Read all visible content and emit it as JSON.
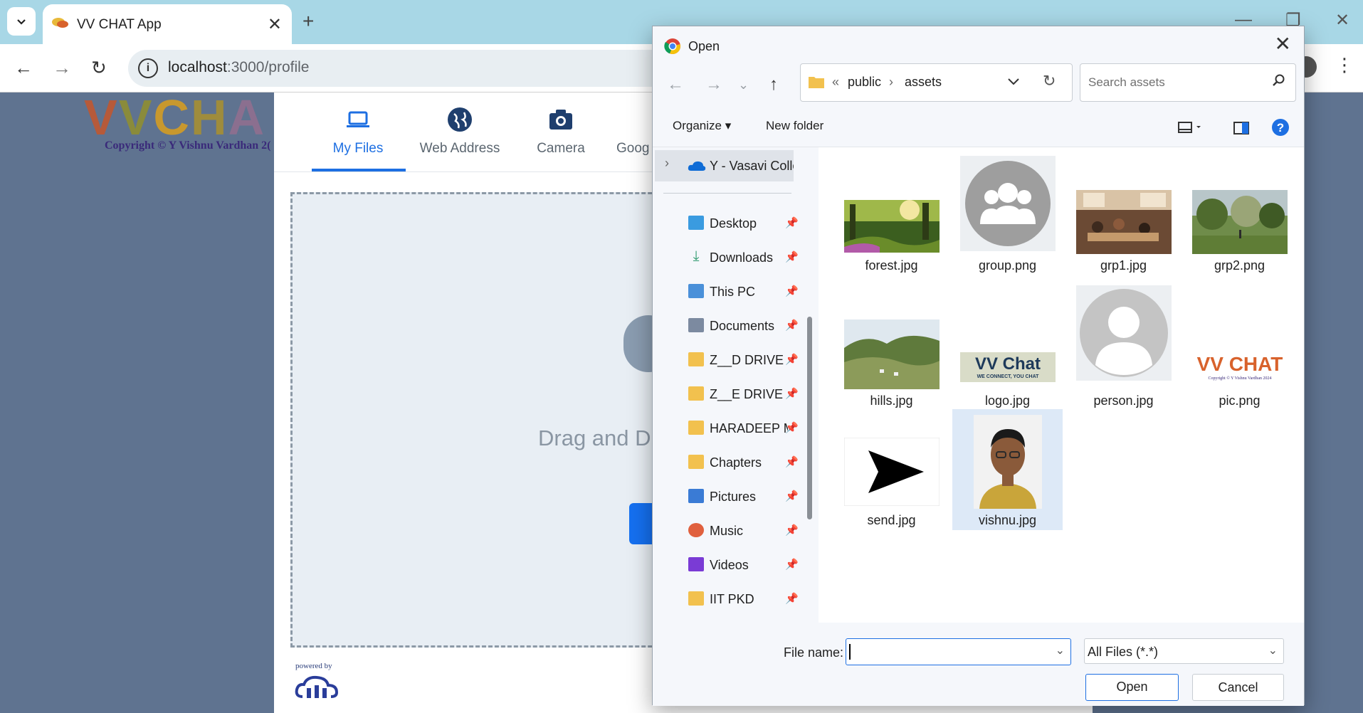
{
  "browser": {
    "tab_title": "VV CHAT App",
    "url_host": "localhost",
    "url_path": ":3000/profile",
    "colors": {
      "tabstrip": "#a8d7e6",
      "accent": "#1d6fe2"
    }
  },
  "page": {
    "brand_letters": [
      "V",
      "V",
      "C",
      "H",
      "A",
      ""
    ],
    "copyright": "Copyright © Y Vishnu Vardhan 2("
  },
  "upload_widget": {
    "tabs": [
      {
        "label": "My Files",
        "icon": "laptop-icon",
        "active": true
      },
      {
        "label": "Web Address",
        "icon": "globe-icon"
      },
      {
        "label": "Camera",
        "icon": "camera-icon"
      },
      {
        "label": "Goog",
        "icon": "google-drive-icon"
      }
    ],
    "drag_text": "Drag and Dr",
    "powered_by": "powered by"
  },
  "dialog": {
    "title": "Open",
    "address": {
      "overflow": "«",
      "crumbs": [
        "public",
        "assets"
      ]
    },
    "search_placeholder": "Search assets",
    "commands": {
      "organize": "Organize",
      "new_folder": "New folder"
    },
    "cloud_item": "Y - Vasavi College",
    "sidebar_items": [
      {
        "label": "Desktop",
        "icon": "desktop-icon",
        "color": "#3a9be0"
      },
      {
        "label": "Downloads",
        "icon": "download-icon",
        "color": "#2e9a6e"
      },
      {
        "label": "This PC",
        "icon": "computer-icon",
        "color": "#4a90d9"
      },
      {
        "label": "Documents",
        "icon": "document-icon",
        "color": "#7c8aa0"
      },
      {
        "label": "Z__D DRIVE",
        "icon": "folder-icon",
        "color": "#f2c14e"
      },
      {
        "label": "Z__E DRIVE",
        "icon": "folder-icon",
        "color": "#f2c14e"
      },
      {
        "label": "HARADEEP M",
        "icon": "folder-icon",
        "color": "#f2c14e"
      },
      {
        "label": "Chapters",
        "icon": "folder-icon",
        "color": "#f2c14e"
      },
      {
        "label": "Pictures",
        "icon": "pictures-icon",
        "color": "#3a7bd5"
      },
      {
        "label": "Music",
        "icon": "music-icon",
        "color": "#e0603e"
      },
      {
        "label": "Videos",
        "icon": "videos-icon",
        "color": "#7a3bd5"
      },
      {
        "label": "IIT PKD",
        "icon": "folder-icon",
        "color": "#f2c14e"
      }
    ],
    "files": [
      {
        "name": "forest.jpg",
        "kind": "photo-forest"
      },
      {
        "name": "group.png",
        "kind": "group-avatar"
      },
      {
        "name": "grp1.jpg",
        "kind": "photo-cafe"
      },
      {
        "name": "grp2.png",
        "kind": "photo-park"
      },
      {
        "name": "hills.jpg",
        "kind": "photo-hills"
      },
      {
        "name": "logo.jpg",
        "kind": "logo",
        "logo_text": "VV Chat",
        "logo_tagline": "WE CONNECT, YOU CHAT"
      },
      {
        "name": "person.jpg",
        "kind": "person-avatar"
      },
      {
        "name": "pic.png",
        "kind": "logo-pic",
        "logo_text": "VV CHAT",
        "logo_tagline": "Copyright © Y Vishnu Vardhan 2024"
      },
      {
        "name": "send.jpg",
        "kind": "send-arrow"
      },
      {
        "name": "vishnu.jpg",
        "kind": "photo-portrait",
        "selected": true
      }
    ],
    "footer": {
      "file_name_label": "File name:",
      "file_name_value": "",
      "file_type": "All Files (*.*)",
      "open_label": "Open",
      "cancel_label": "Cancel"
    }
  }
}
